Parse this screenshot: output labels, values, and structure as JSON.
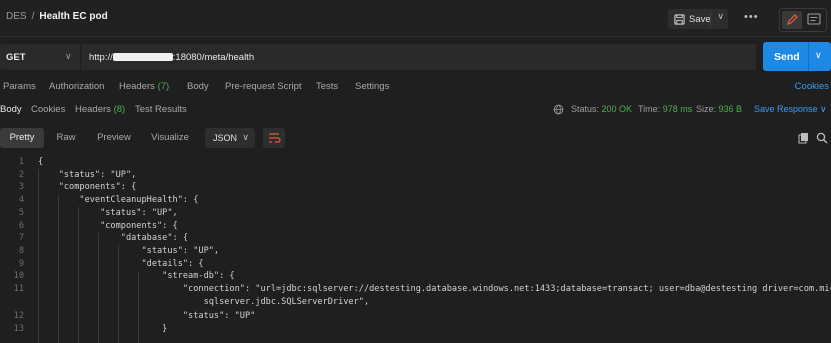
{
  "header": {
    "breadcrumb_parent": "DES",
    "breadcrumb_separator": "/",
    "title": "Health EC pod",
    "save_label": "Save",
    "more_label": "•••"
  },
  "request": {
    "method": "GET",
    "url_prefix": "http://",
    "url_suffix": ":18080/meta/health",
    "send_label": "Send"
  },
  "request_tabs": [
    {
      "label": "Params"
    },
    {
      "label": "Authorization"
    },
    {
      "label": "Headers",
      "count": "(7)"
    },
    {
      "label": "Body"
    },
    {
      "label": "Pre-request Script"
    },
    {
      "label": "Tests"
    },
    {
      "label": "Settings"
    }
  ],
  "cookies_link": "Cookies",
  "response_tabs": [
    {
      "label": "Body"
    },
    {
      "label": "Cookies"
    },
    {
      "label": "Headers",
      "count": "(8)"
    },
    {
      "label": "Test Results"
    }
  ],
  "response_status": {
    "status_label": "Status:",
    "status_value": "200 OK",
    "time_label": "Time:",
    "time_value": "978 ms",
    "size_label": "Size:",
    "size_value": "936 B",
    "save_response": "Save Response ∨"
  },
  "view_tabs": [
    "Pretty",
    "Raw",
    "Preview",
    "Visualize"
  ],
  "format": "JSON",
  "code_lines": [
    {
      "n": "1",
      "text": "{"
    },
    {
      "n": "2",
      "text": "    \"status\": \"UP\","
    },
    {
      "n": "3",
      "text": "    \"components\": {"
    },
    {
      "n": "4",
      "text": "        \"eventCleanupHealth\": {"
    },
    {
      "n": "5",
      "text": "            \"status\": \"UP\","
    },
    {
      "n": "6",
      "text": "            \"components\": {"
    },
    {
      "n": "7",
      "text": "                \"database\": {"
    },
    {
      "n": "8",
      "text": "                    \"status\": \"UP\","
    },
    {
      "n": "9",
      "text": "                    \"details\": {"
    },
    {
      "n": "10",
      "text": "                        \"stream-db\": {"
    },
    {
      "n": "11",
      "text": "                            \"connection\": \"url=jdbc:sqlserver://destesting.database.windows.net:1433;database=transact; user=dba@destesting driver=com.microsoft."
    },
    {
      "n": "",
      "text": "                                sqlserver.jdbc.SQLServerDriver\","
    },
    {
      "n": "12",
      "text": "                            \"status\": \"UP\""
    },
    {
      "n": "13",
      "text": "                        }"
    }
  ]
}
